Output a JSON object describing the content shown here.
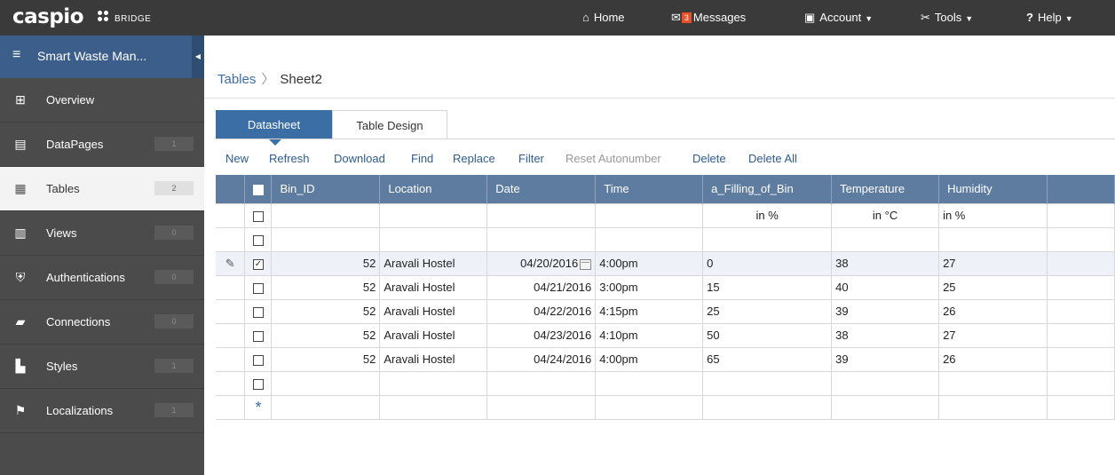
{
  "topbar": {
    "logo": "caspio",
    "logo_sub": "BRIDGE",
    "home": "Home",
    "messages_count": "3",
    "messages": "Messages",
    "account": "Account",
    "tools": "Tools",
    "help": "Help"
  },
  "sidebar": {
    "app_title": "Smart Waste Man...",
    "items": [
      {
        "label": "Overview",
        "count": ""
      },
      {
        "label": "DataPages",
        "count": "1"
      },
      {
        "label": "Tables",
        "count": "2"
      },
      {
        "label": "Views",
        "count": "0"
      },
      {
        "label": "Authentications",
        "count": "0"
      },
      {
        "label": "Connections",
        "count": "0"
      },
      {
        "label": "Styles",
        "count": "1"
      },
      {
        "label": "Localizations",
        "count": "1"
      }
    ]
  },
  "breadcrumb": {
    "parent": "Tables",
    "current": "Sheet2"
  },
  "tabs": {
    "datasheet": "Datasheet",
    "table_design": "Table Design"
  },
  "actions": [
    "New",
    "Refresh",
    "Download",
    "Find",
    "Replace",
    "Filter",
    "Reset Autonumber",
    "Delete",
    "Delete All"
  ],
  "columns": [
    "Bin_ID",
    "Location",
    "Date",
    "Time",
    "a_Filling_of_Bin",
    "Temperature",
    "Humidity"
  ],
  "units": {
    "filling": "in %",
    "temperature": "in °C",
    "humidity": "in %"
  },
  "rows": [
    {
      "bin_id": "52",
      "location": "Aravali Hostel",
      "date": "04/20/2016",
      "time": "4:00pm",
      "filling": "0",
      "temperature": "38",
      "humidity": "27"
    },
    {
      "bin_id": "52",
      "location": "Aravali Hostel",
      "date": "04/21/2016",
      "time": "3:00pm",
      "filling": "15",
      "temperature": "40",
      "humidity": "25"
    },
    {
      "bin_id": "52",
      "location": "Aravali Hostel",
      "date": "04/22/2016",
      "time": "4:15pm",
      "filling": "25",
      "temperature": "39",
      "humidity": "26"
    },
    {
      "bin_id": "52",
      "location": "Aravali Hostel",
      "date": "04/23/2016",
      "time": "4:10pm",
      "filling": "50",
      "temperature": "38",
      "humidity": "27"
    },
    {
      "bin_id": "52",
      "location": "Aravali Hostel",
      "date": "04/24/2016",
      "time": "4:00pm",
      "filling": "65",
      "temperature": "39",
      "humidity": "26"
    }
  ],
  "colors": {
    "topbar": "#3a3a3a",
    "sidebar": "#4b4b4b",
    "accent": "#3b6ea5",
    "header": "#5e7ba0",
    "badge": "#e8502a"
  }
}
